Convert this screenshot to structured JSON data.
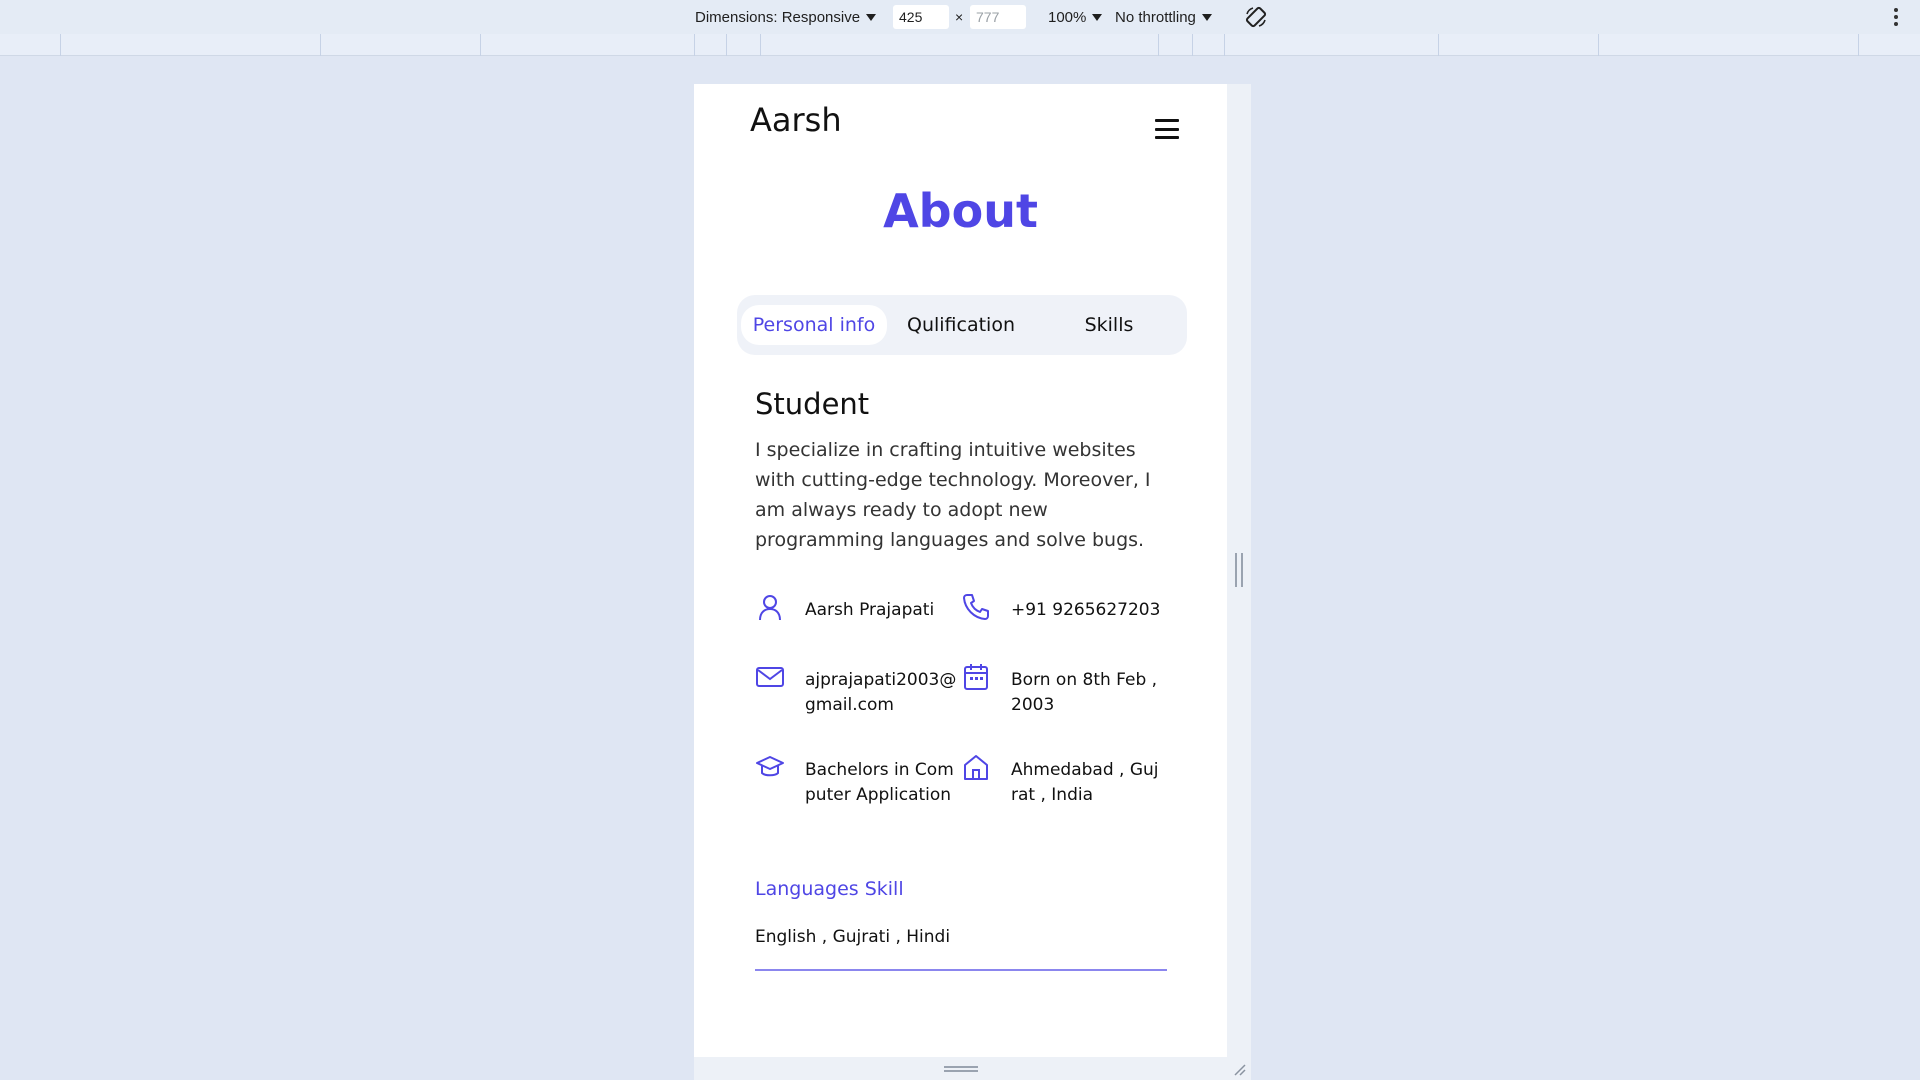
{
  "devtools": {
    "dimensions_label": "Dimensions: Responsive",
    "width_value": "425",
    "times": "×",
    "height_value": "777",
    "zoom": "100%",
    "throttling": "No throttling",
    "rotate_icon": "rotate-icon",
    "more_icon": "kebab-menu-icon"
  },
  "site": {
    "logo": "Aarsh",
    "menu_icon": "hamburger-menu-icon",
    "heading": "About",
    "tabs": [
      {
        "label": "Personal info",
        "active": true
      },
      {
        "label": "Qulification",
        "active": false
      },
      {
        "label": "Skills",
        "active": false
      }
    ],
    "role": "Student",
    "description": "I specialize in crafting intuitive websites with cutting-edge technology. Moreover, I am always ready to adopt new programming languages and solve bugs.",
    "info": [
      {
        "icon": "user-icon",
        "text": "Aarsh Prajapati"
      },
      {
        "icon": "phone-icon",
        "text": "+91 9265627203"
      },
      {
        "icon": "mail-icon",
        "text": "ajprajapati2003@gmail.com"
      },
      {
        "icon": "calendar-icon",
        "text": "Born on 8th Feb , 2003"
      },
      {
        "icon": "graduation-cap-icon",
        "text": "Bachelors in Computer Application"
      },
      {
        "icon": "home-icon",
        "text": "Ahmedabad , Gujrat , India"
      }
    ],
    "languages_title": "Languages Skill",
    "languages_value": "English , Gujrati , Hindi"
  },
  "colors": {
    "accent": "#4f46e5",
    "page_bg": "#dfe6f3",
    "tabs_bg": "#eff2f8"
  }
}
